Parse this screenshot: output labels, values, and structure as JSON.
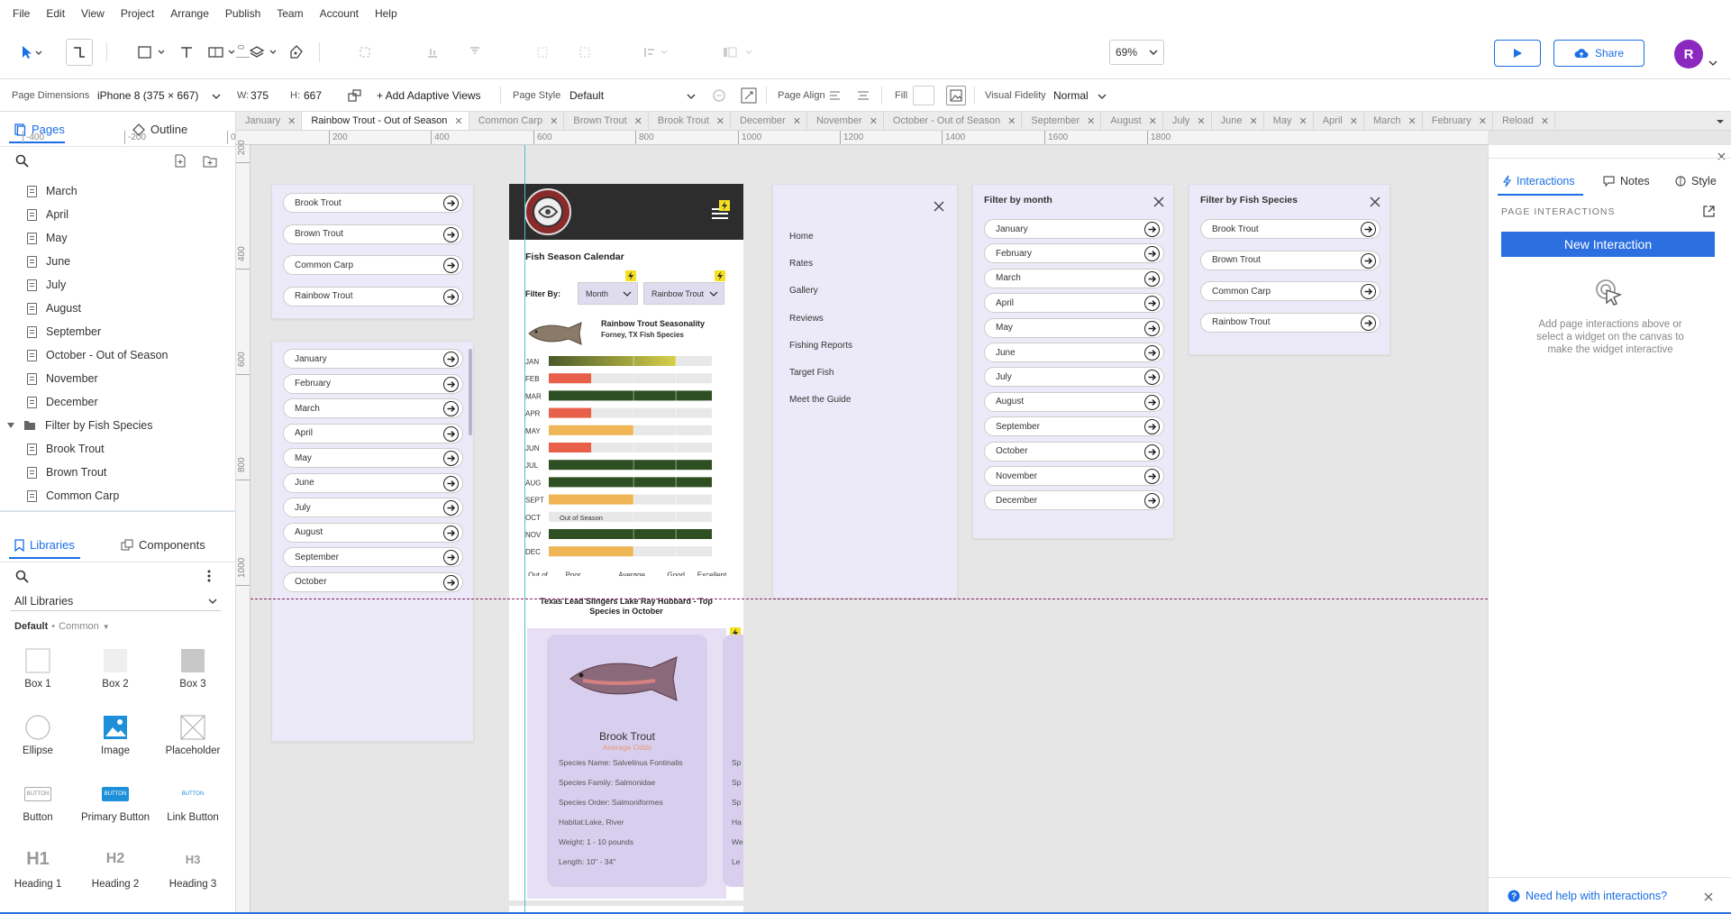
{
  "menu": [
    "File",
    "Edit",
    "View",
    "Project",
    "Arrange",
    "Publish",
    "Team",
    "Account",
    "Help"
  ],
  "toolbar": {
    "zoom": "69%",
    "share_label": "Share",
    "avatar_initial": "R"
  },
  "properties": {
    "page_dimensions_label": "Page Dimensions",
    "page_dimensions_value": "iPhone 8  (375 × 667)",
    "w_label": "W:",
    "w_value": "375",
    "h_label": "H:",
    "h_value": "667",
    "add_adaptive": "+ Add Adaptive Views",
    "page_style_label": "Page Style",
    "page_style_value": "Default",
    "page_align_label": "Page Align",
    "fill_label": "Fill",
    "visual_fidelity_label": "Visual Fidelity",
    "visual_fidelity_value": "Normal"
  },
  "tabs": [
    {
      "label": "January"
    },
    {
      "label": "Rainbow Trout - Out of Season",
      "active": true
    },
    {
      "label": "Common Carp"
    },
    {
      "label": "Brown Trout"
    },
    {
      "label": "Brook Trout"
    },
    {
      "label": "December"
    },
    {
      "label": "November"
    },
    {
      "label": "October - Out of Season"
    },
    {
      "label": "September"
    },
    {
      "label": "August"
    },
    {
      "label": "July"
    },
    {
      "label": "June"
    },
    {
      "label": "May"
    },
    {
      "label": "April"
    },
    {
      "label": "March"
    },
    {
      "label": "February"
    },
    {
      "label": "Reload"
    }
  ],
  "ruler": {
    "top": [
      "-400",
      "-200",
      "0",
      "200",
      "400",
      "600",
      "800",
      "1000",
      "1200",
      "1400",
      "1600",
      "1800"
    ],
    "left": [
      "0",
      "200",
      "400",
      "600",
      "800",
      "1000"
    ]
  },
  "left_panel": {
    "pages_tab": "Pages",
    "outline_tab": "Outline",
    "pages": [
      {
        "label": "March"
      },
      {
        "label": "April"
      },
      {
        "label": "May"
      },
      {
        "label": "June"
      },
      {
        "label": "July"
      },
      {
        "label": "August"
      },
      {
        "label": "September"
      },
      {
        "label": "October - Out of Season"
      },
      {
        "label": "November"
      },
      {
        "label": "December"
      },
      {
        "label": "Filter by Fish Species",
        "folder": true
      },
      {
        "label": "Brook Trout"
      },
      {
        "label": "Brown Trout"
      },
      {
        "label": "Common Carp"
      },
      {
        "label": "Rainbow Trout - Out of Season",
        "selected": true
      }
    ],
    "libraries_tab": "Libraries",
    "components_tab": "Components",
    "library_select": "All Libraries",
    "library_source": "Default",
    "library_group": "Common",
    "widgets": [
      "Box 1",
      "Box 2",
      "Box 3",
      "Ellipse",
      "Image",
      "Placeholder",
      "Button",
      "Primary Button",
      "Link Button",
      "Heading 1",
      "Heading 2",
      "Heading 3"
    ],
    "button_thumb_text": "BUTTON",
    "h1": "H1",
    "h2": "H2",
    "h3": "H3"
  },
  "canvas": {
    "species_list": [
      "Brook Trout",
      "Brown Trout",
      "Common Carp",
      "Rainbow Trout"
    ],
    "month_list": [
      "January",
      "February",
      "March",
      "April",
      "May",
      "June",
      "July",
      "August",
      "September",
      "October"
    ],
    "phone": {
      "title": "Fish Season Calendar",
      "filter_by": "Filter By:",
      "filter_month": "Month",
      "filter_species": "Rainbow Trout",
      "chart_title": "Rainbow Trout Seasonality",
      "chart_subtitle": "Forney, TX Fish Species",
      "section_title": "Texas Lead Slingers Lake Ray Hubbard - Top Species in October",
      "card_name": "Brook Trout",
      "card_odds": "Average Odds",
      "card_details": [
        "Species Name: Salvelinus Fontinalis",
        "Species Family: Salmonidae",
        "Species Order: Salmoniformes",
        "Habitat:Lake, River",
        "Weight: 1 - 10 pounds",
        "Length: 10\" - 34\""
      ],
      "card2_prefixes": [
        "Sp",
        "Sp",
        "Sp",
        "Ha",
        "We",
        "Le"
      ]
    },
    "nav_menu": [
      "Home",
      "Rates",
      "Gallery",
      "Reviews",
      "Fishing Reports",
      "Target Fish",
      "Meet the Guide"
    ],
    "filter_month_title": "Filter by month",
    "filter_month_items": [
      "January",
      "February",
      "March",
      "April",
      "May",
      "June",
      "July",
      "August",
      "September",
      "October",
      "November",
      "December"
    ],
    "filter_species_title": "Filter by Fish Species",
    "filter_species_items": [
      "Brook Trout",
      "Brown Trout",
      "Common Carp",
      "Rainbow Trout"
    ]
  },
  "chart_data": {
    "type": "bar",
    "title": "Rainbow Trout Seasonality",
    "subtitle": "Forney, TX Fish Species",
    "categories": [
      "JAN",
      "FEB",
      "MAR",
      "APR",
      "MAY",
      "JUN",
      "JUL",
      "AUG",
      "SEPT",
      "OCT",
      "NOV",
      "DEC"
    ],
    "values": [
      3,
      1,
      4,
      1,
      2,
      1,
      4,
      4,
      2,
      0,
      4,
      2
    ],
    "annotations": [
      {
        "category": "OCT",
        "text": "Out of Season"
      }
    ],
    "x_tick_labels": [
      "Out of Season",
      "Poor",
      "Average",
      "Good",
      "Excellent"
    ],
    "xlim": [
      0,
      4
    ],
    "colors": {
      "poor": "#e8604a",
      "average": "#f0b555",
      "good": "#c8c84a",
      "excellent": "#2e4f22"
    }
  },
  "right_panel": {
    "tabs": [
      "Interactions",
      "Notes",
      "Style"
    ],
    "section_title": "PAGE INTERACTIONS",
    "new_interaction": "New Interaction",
    "hint": "Add page interactions above or select a widget on the canvas to make the widget interactive",
    "help": "Need help with interactions?"
  }
}
